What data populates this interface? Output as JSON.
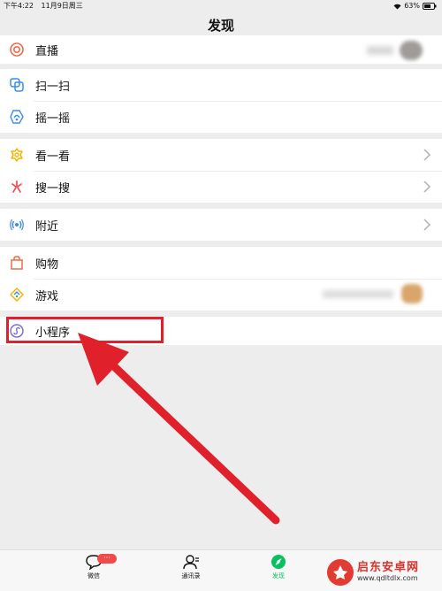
{
  "status_bar": {
    "time": "下午4:22",
    "date": "11月9日周三",
    "battery": "63%"
  },
  "nav": {
    "title": "发现"
  },
  "groups": [
    {
      "items": [
        {
          "label": "直播",
          "icon": "live-icon"
        }
      ]
    },
    {
      "items": [
        {
          "label": "扫一扫",
          "icon": "scan-icon"
        },
        {
          "label": "摇一摇",
          "icon": "shake-icon"
        }
      ]
    },
    {
      "items": [
        {
          "label": "看一看",
          "icon": "look-icon"
        },
        {
          "label": "搜一搜",
          "icon": "search-icon"
        }
      ]
    },
    {
      "items": [
        {
          "label": "附近",
          "icon": "nearby-icon"
        }
      ]
    },
    {
      "items": [
        {
          "label": "购物",
          "icon": "shopping-icon"
        },
        {
          "label": "游戏",
          "icon": "game-icon"
        }
      ]
    },
    {
      "items": [
        {
          "label": "小程序",
          "icon": "mini-program-icon"
        }
      ]
    }
  ],
  "tabbar": {
    "chats": "微信",
    "chats_badge": "···",
    "contacts": "通讯录",
    "discover": "发现"
  },
  "watermark": {
    "title": "启东安卓网",
    "url": "www.qdltdlx.com"
  },
  "colors": {
    "accent": "#07c160",
    "highlight": "#e0202a",
    "background": "#ededed"
  }
}
